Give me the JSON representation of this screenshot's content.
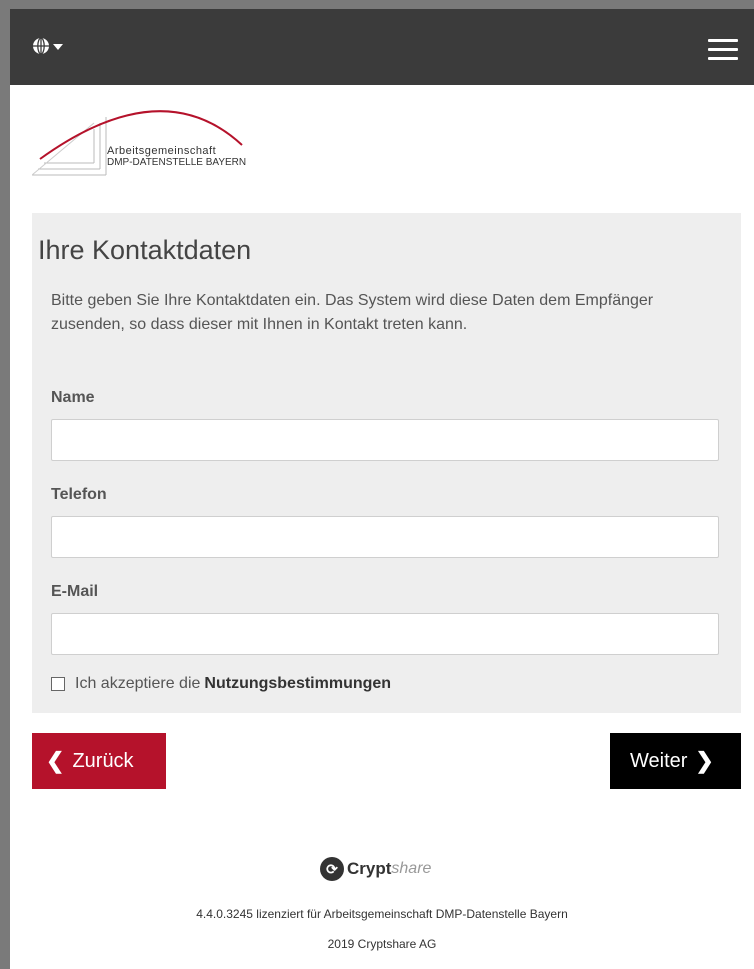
{
  "header": {
    "language_icon": "globe-icon",
    "menu_icon": "hamburger-menu-icon"
  },
  "logo": {
    "line1": "Arbeitsgemeinschaft",
    "line2": "DMP-DATENSTELLE BAYERN",
    "accent_color": "#b5122b"
  },
  "form": {
    "title": "Ihre Kontaktdaten",
    "intro": "Bitte geben Sie Ihre Kontaktdaten ein. Das System wird diese Daten dem Empfänger zusenden, so dass dieser mit Ihnen in Kontakt treten kann.",
    "fields": {
      "name": {
        "label": "Name",
        "value": ""
      },
      "phone": {
        "label": "Telefon",
        "value": ""
      },
      "email": {
        "label": "E-Mail",
        "value": ""
      }
    },
    "terms": {
      "prefix": "Ich akzeptiere die",
      "link": "Nutzungsbestimmungen",
      "checked": false
    }
  },
  "buttons": {
    "back": "Zurück",
    "next": "Weiter",
    "back_color": "#b5122b",
    "next_color": "#000000"
  },
  "footer": {
    "brand_bold": "Crypt",
    "brand_light": "share",
    "license": "4.4.0.3245 lizenziert für Arbeitsgemeinschaft DMP-Datenstelle Bayern",
    "copyright": "2019 Cryptshare AG"
  }
}
